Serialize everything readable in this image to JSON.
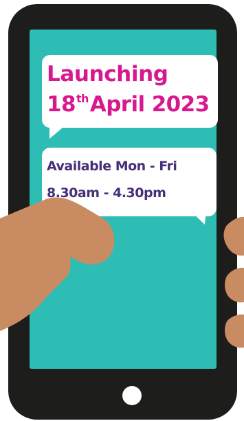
{
  "launch": {
    "label": "Launching",
    "day": "18",
    "day_suffix": "th",
    "month_year": "April 2023"
  },
  "hours": {
    "days": "Available Mon - Fri",
    "times": "8.30am - 4.30pm"
  },
  "colors": {
    "phone_body": "#1d1d1b",
    "screen": "#2dbdb4",
    "bubble": "#ffffff",
    "launch_text": "#d7198f",
    "hours_text": "#46307a",
    "hand_skin": "#c98b62",
    "home_button": "#ffffff"
  },
  "icons": {
    "home_button": "home-button-icon",
    "speech_bubble": "speech-bubble-icon",
    "hand": "pointing-hand-icon"
  }
}
